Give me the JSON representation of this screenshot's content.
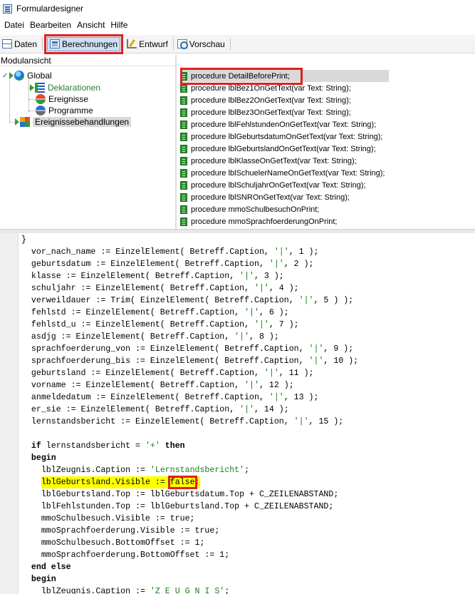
{
  "window": {
    "title": "Formulardesigner"
  },
  "menu": [
    "Datei",
    "Bearbeiten",
    "Ansicht",
    "Hilfe"
  ],
  "toolbar": {
    "buttons": [
      {
        "label": "Daten",
        "icon": "data-icon"
      },
      {
        "label": "Berechnungen",
        "icon": "calculator-icon",
        "active": true
      },
      {
        "label": "Entwurf",
        "icon": "draft-icon"
      },
      {
        "label": "Vorschau",
        "icon": "preview-icon"
      }
    ]
  },
  "module_view": {
    "title": "Modulansicht",
    "tree": {
      "root": "Global",
      "children": [
        "Deklarationen",
        "Ereignisse",
        "Programme"
      ],
      "sibling": "Ereignissebehandlungen"
    }
  },
  "procedures": [
    "procedure DetailBeforePrint;",
    "procedure lblBez1OnGetText(var Text: String);",
    "procedure lblBez2OnGetText(var Text: String);",
    "procedure lblBez3OnGetText(var Text: String);",
    "procedure lblFehlstundenOnGetText(var Text: String);",
    "procedure lblGeburtsdatumOnGetText(var Text: String);",
    "procedure lblGeburtslandOnGetText(var Text: String);",
    "procedure lblKlasseOnGetText(var Text: String);",
    "procedure lblSchuelerNameOnGetText(var Text: String);",
    "procedure lblSchuljahrOnGetText(var Text: String);",
    "procedure lblSNROnGetText(var Text: String);",
    "procedure mmoSchulbesuchOnPrint;",
    "procedure mmoSprachfoerderungOnPrint;"
  ],
  "selected_procedure": "procedure DetailBeforePrint;",
  "code": {
    "lines": [
      "}",
      "  vor_nach_name := EinzelElement( Betreff.Caption, '|', 1 );",
      "  geburtsdatum := EinzelElement( Betreff.Caption, '|', 2 );",
      "  klasse := EinzelElement( Betreff.Caption, '|', 3 );",
      "  schuljahr := EinzelElement( Betreff.Caption, '|', 4 );",
      "  verweildauer := Trim( EinzelElement( Betreff.Caption, '|', 5 ) );",
      "  fehlstd := EinzelElement( Betreff.Caption, '|', 6 );",
      "  fehlstd_u := EinzelElement( Betreff.Caption, '|', 7 );",
      "  asdjg := EinzelElement( Betreff.Caption, '|', 8 );",
      "  sprachfoerderung_von := EinzelElement( Betreff.Caption, '|', 9 );",
      "  sprachfoerderung_bis := EinzelElement( Betreff.Caption, '|', 10 );",
      "  geburtsland := EinzelElement( Betreff.Caption, '|', 11 );",
      "  vorname := EinzelElement( Betreff.Caption, '|', 12 );",
      "  anmeldedatum := EinzelElement( Betreff.Caption, '|', 13 );",
      "  er_sie := EinzelElement( Betreff.Caption, '|', 14 );",
      "  lernstandsbericht := EinzelElement( Betreff.Caption, '|', 15 );",
      "",
      "  if lernstandsbericht = '+' then",
      "  begin",
      "    lblZeugnis.Caption := 'Lernstandsbericht';",
      "    lblGeburtsland.Visible := false;",
      "    lblGeburtsland.Top := lblGeburtsdatum.Top + C_ZEILENABSTAND;",
      "    lblFehlstunden.Top := lblGeburtsland.Top + C_ZEILENABSTAND;",
      "    mmoSchulbesuch.Visible := true;",
      "    mmoSprachfoerderung.Visible := true;",
      "    mmoSchulbesuch.BottomOffset := 1;",
      "    mmoSprachfoerderung.BottomOffset := 1;",
      "  end else",
      "  begin",
      "    lblZeugnis.Caption := 'Z E U G N I S';"
    ],
    "highlighted_line": "    lblGeburtsland.Visible := false;",
    "highlighted_token": "false"
  }
}
